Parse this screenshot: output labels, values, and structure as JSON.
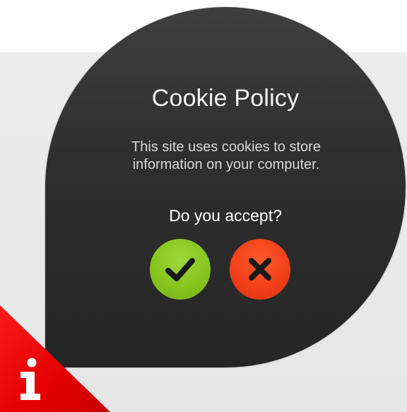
{
  "cookie_dialog": {
    "title": "Cookie Policy",
    "message_line1": "This site uses cookies to store",
    "message_line2": "information on your computer.",
    "question": "Do you accept?",
    "accept_icon": "checkmark-icon",
    "decline_icon": "x-icon"
  },
  "info_badge": {
    "glyph": "i",
    "icon": "info-icon"
  },
  "colors": {
    "bubble": "#2f2f2f",
    "accept": "#86c520",
    "decline": "#f2401a",
    "info_badge": "#e40000"
  }
}
